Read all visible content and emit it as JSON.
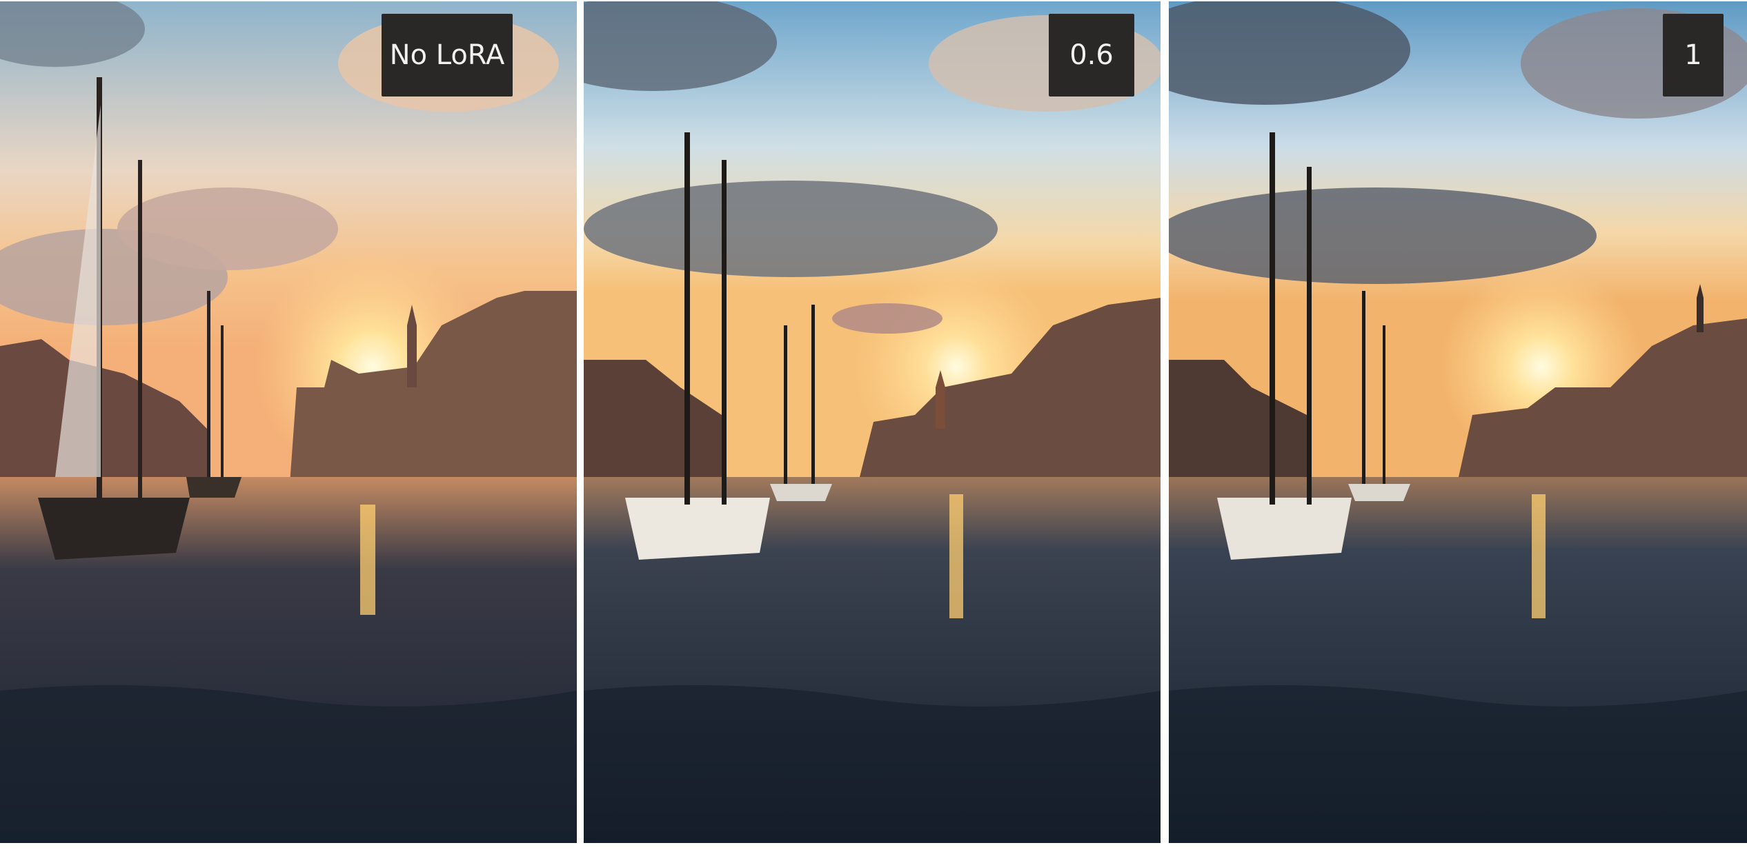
{
  "panels": [
    {
      "label": "No LoRA",
      "scene": "harbor-sunset-photo"
    },
    {
      "label": "0.6",
      "scene": "harbor-sunset-photo"
    },
    {
      "label": "1",
      "scene": "harbor-sunset-photo"
    }
  ],
  "colors": {
    "sky_top": "#7fb0d4",
    "sky_mid": "#f1d6b4",
    "horizon": "#f7b86b",
    "sun": "#fff3c2",
    "water_dark": "#1b2230",
    "water_glow": "#f0a24a",
    "buildings": "#5a4238",
    "boat_hull": "#e8e4dc",
    "label_bg": "#2a2826"
  }
}
